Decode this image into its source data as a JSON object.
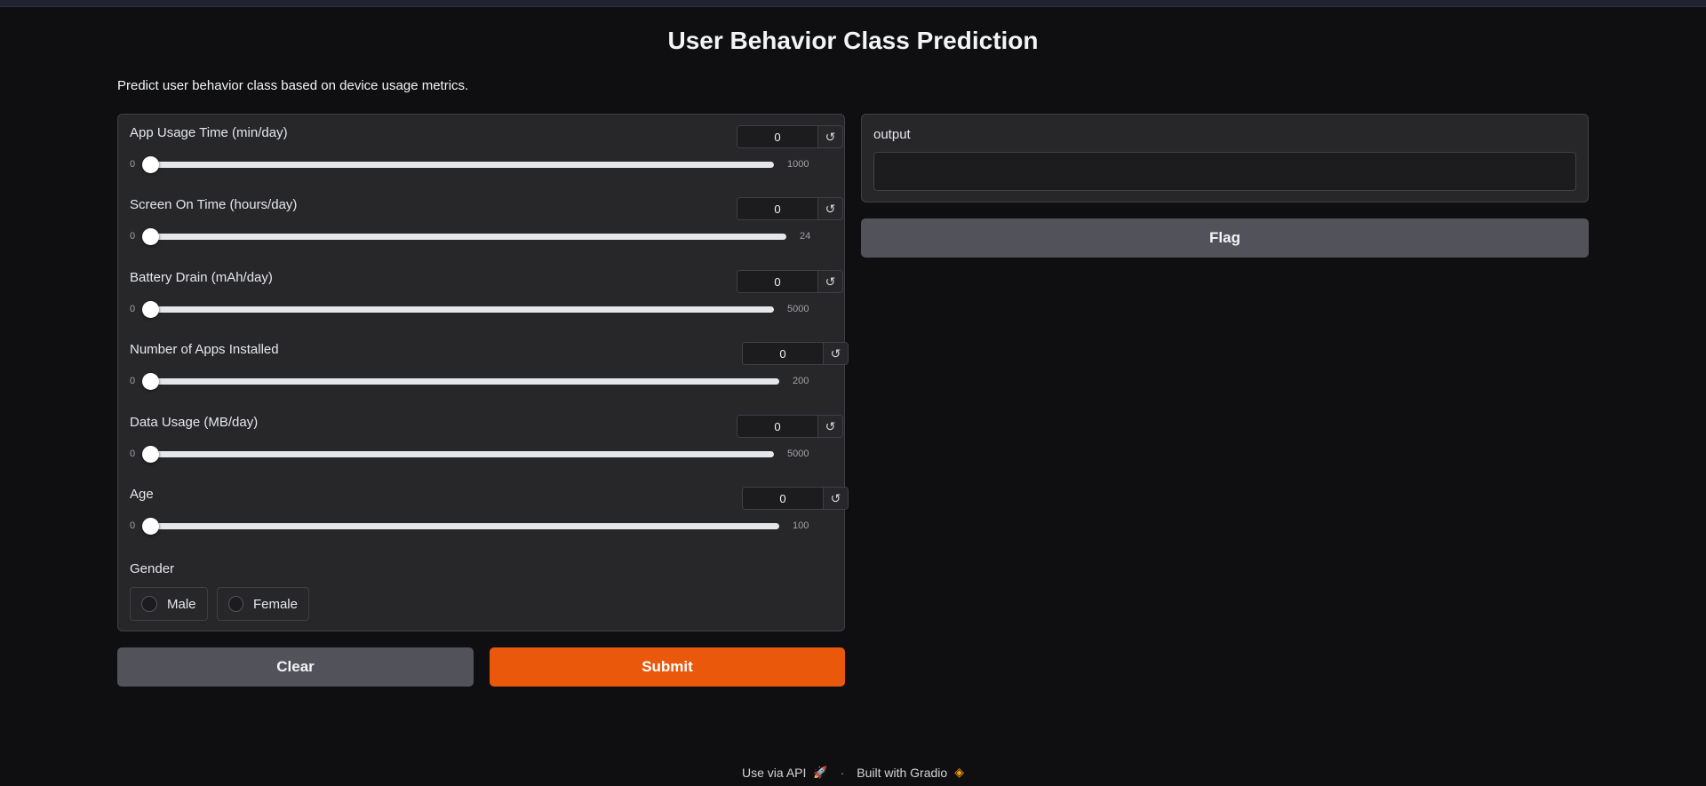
{
  "header": {
    "title": "User Behavior Class Prediction",
    "description": "Predict user behavior class based on device usage metrics."
  },
  "inputs": {
    "app_usage": {
      "label": "App Usage Time (min/day)",
      "value": "0",
      "min": "0",
      "max": "1000"
    },
    "screen_on": {
      "label": "Screen On Time (hours/day)",
      "value": "0",
      "min": "0",
      "max": "24"
    },
    "battery": {
      "label": "Battery Drain (mAh/day)",
      "value": "0",
      "min": "0",
      "max": "5000"
    },
    "num_apps": {
      "label": "Number of Apps Installed",
      "value": "0",
      "min": "0",
      "max": "200"
    },
    "data_usage": {
      "label": "Data Usage (MB/day)",
      "value": "0",
      "min": "0",
      "max": "5000"
    },
    "age": {
      "label": "Age",
      "value": "0",
      "min": "0",
      "max": "100"
    },
    "reset_icon": "↺",
    "gender": {
      "label": "Gender",
      "options": [
        "Male",
        "Female"
      ]
    }
  },
  "actions": {
    "clear": "Clear",
    "submit": "Submit",
    "flag": "Flag"
  },
  "output": {
    "label": "output",
    "value": ""
  },
  "footer": {
    "api": "Use via API",
    "rocket_icon": "🚀",
    "separator": "·",
    "built": "Built with Gradio",
    "logo_icon": "◈"
  },
  "colors": {
    "accent": "#ea580c",
    "background": "#0f0f11",
    "panel": "#27272a",
    "secondary_button": "#52525b"
  }
}
